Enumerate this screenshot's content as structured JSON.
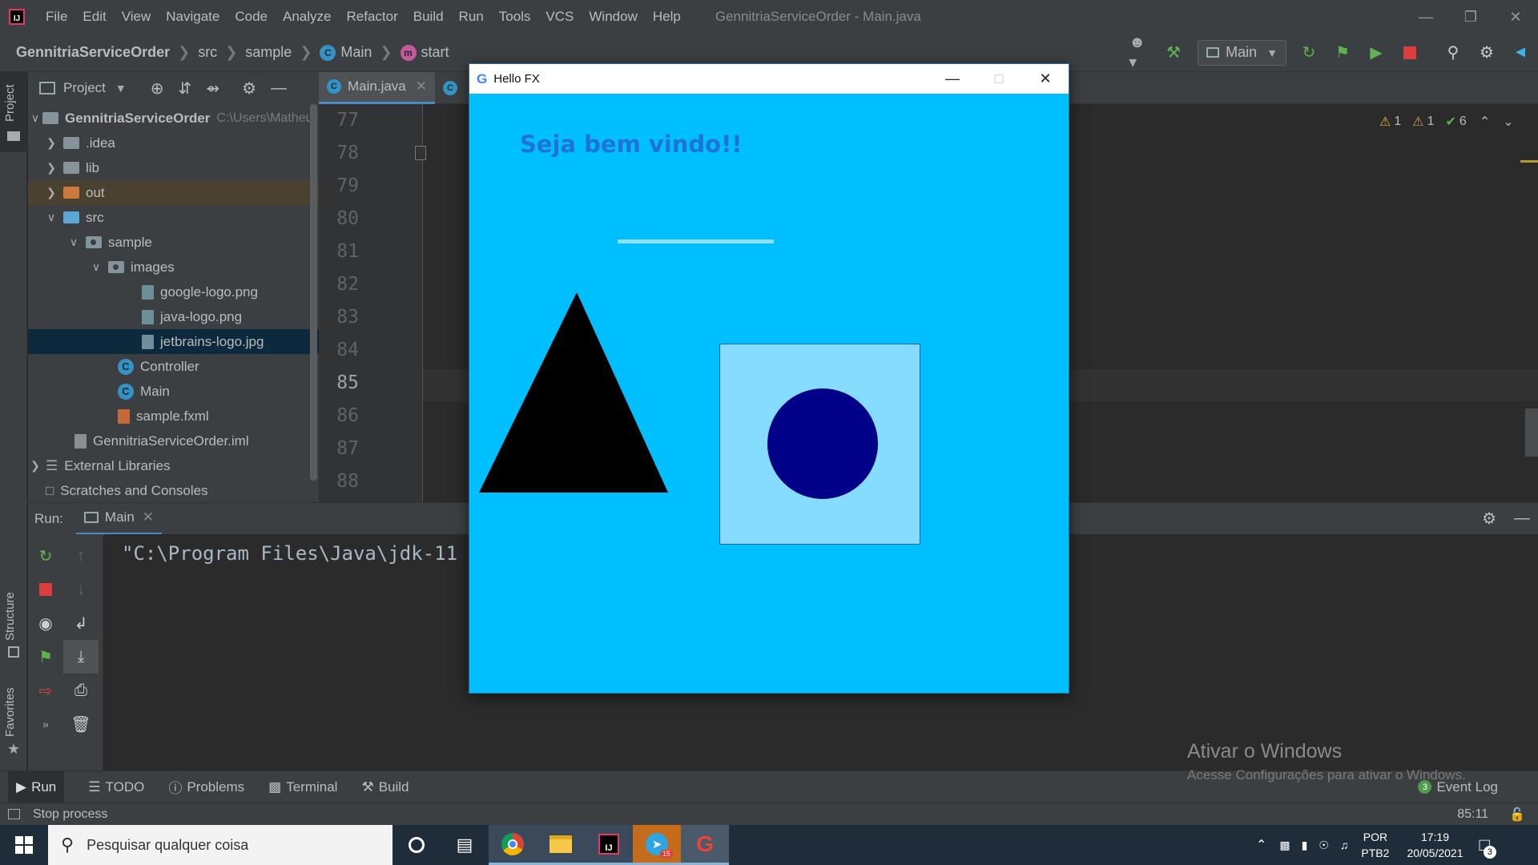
{
  "menubar": {
    "items": [
      "File",
      "Edit",
      "View",
      "Navigate",
      "Code",
      "Analyze",
      "Refactor",
      "Build",
      "Run",
      "Tools",
      "VCS",
      "Window",
      "Help"
    ],
    "window_title": "GennitriaServiceOrder - Main.java"
  },
  "navbar": {
    "breadcrumbs": [
      "GennitriaServiceOrder",
      "src",
      "sample",
      "Main",
      "start"
    ],
    "run_config": "Main"
  },
  "project_panel": {
    "title": "Project",
    "tree": [
      {
        "label": "GennitriaServiceOrder",
        "hint": "C:\\Users\\Matheu"
      },
      {
        "label": ".idea"
      },
      {
        "label": "lib"
      },
      {
        "label": "out"
      },
      {
        "label": "src"
      },
      {
        "label": "sample"
      },
      {
        "label": "images"
      },
      {
        "label": "google-logo.png"
      },
      {
        "label": "java-logo.png"
      },
      {
        "label": "jetbrains-logo.jpg"
      },
      {
        "label": "Controller"
      },
      {
        "label": "Main"
      },
      {
        "label": "sample.fxml"
      },
      {
        "label": "GennitriaServiceOrder.iml"
      },
      {
        "label": "External Libraries"
      },
      {
        "label": "Scratches and Consoles"
      }
    ]
  },
  "left_stripe": {
    "project": "Project",
    "structure": "Structure",
    "favorites": "Favorites"
  },
  "editor": {
    "tab": "Main.java",
    "line_numbers": [
      "77",
      "78",
      "79",
      "80",
      "81",
      "82",
      "83",
      "84",
      "85",
      "86",
      "87",
      "88"
    ],
    "inspections": {
      "warnings": "1",
      "weak_warnings": "1",
      "ok": "6"
    }
  },
  "run_panel": {
    "label": "Run:",
    "tab": "Main",
    "console_line": "\"C:\\Program Files\\Java\\jdk-11"
  },
  "bottom_tools": [
    "Run",
    "TODO",
    "Problems",
    "Terminal",
    "Build"
  ],
  "event_log": {
    "label": "Event Log",
    "count": "3"
  },
  "status": {
    "text": "Stop process",
    "position": "85:11"
  },
  "watermark": {
    "title": "Ativar o Windows",
    "subtitle": "Acesse Configurações para ativar o Windows."
  },
  "taskbar": {
    "search_placeholder": "Pesquisar qualquer coisa",
    "lang": "POR",
    "layout": "PTB2",
    "time": "17:19",
    "date": "20/05/2021",
    "notifications": "3",
    "telegram_badge": "15"
  },
  "fx_window": {
    "title": "Hello FX",
    "heading": "Seja bem vindo!!",
    "background": "#00bfff"
  }
}
